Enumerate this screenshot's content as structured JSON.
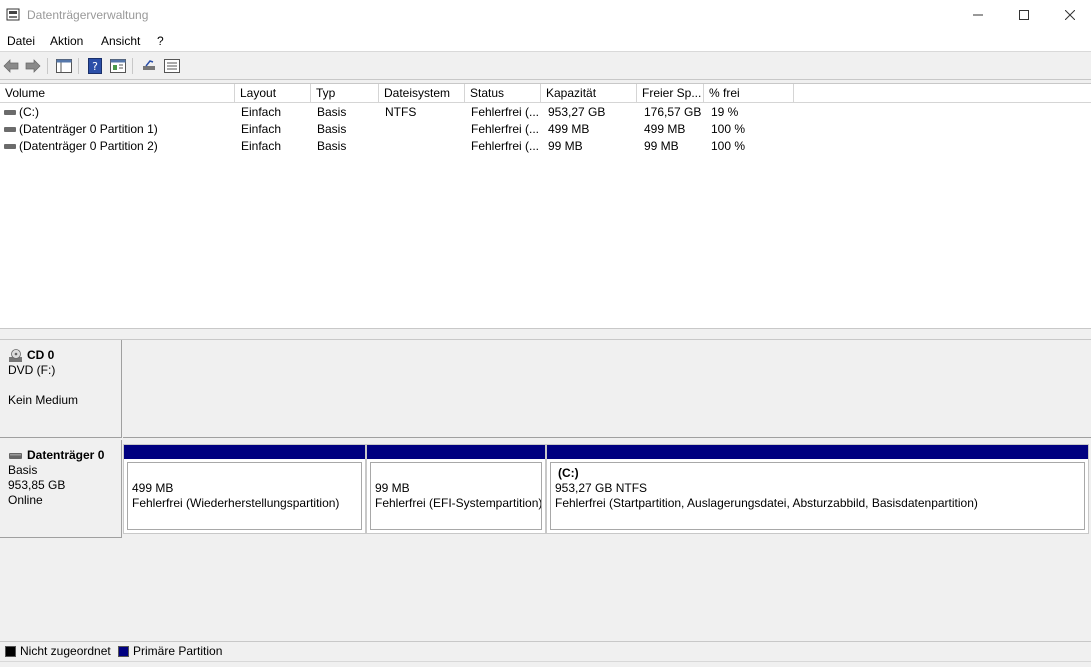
{
  "window": {
    "title": "Datenträgerverwaltung"
  },
  "menu": [
    "Datei",
    "Aktion",
    "Ansicht",
    "?"
  ],
  "toolbar": [
    "back-icon",
    "forward-icon",
    "console-tree-icon",
    "help-icon",
    "properties-icon",
    "connect-icon",
    "settings-icon"
  ],
  "volumes": {
    "columns": [
      "Volume",
      "Layout",
      "Typ",
      "Dateisystem",
      "Status",
      "Kapazität",
      "Freier Sp...",
      "% frei"
    ],
    "rows": [
      {
        "volume": " (C:)",
        "layout": "Einfach",
        "typ": "Basis",
        "fs": "NTFS",
        "status": "Fehlerfrei (...",
        "kap": "953,27 GB",
        "frei": "176,57 GB",
        "pct": "19 %"
      },
      {
        "volume": "(Datenträger 0 Partition 1)",
        "layout": "Einfach",
        "typ": "Basis",
        "fs": "",
        "status": "Fehlerfrei (...",
        "kap": "499 MB",
        "frei": "499 MB",
        "pct": "100 %"
      },
      {
        "volume": "(Datenträger 0 Partition 2)",
        "layout": "Einfach",
        "typ": "Basis",
        "fs": "",
        "status": "Fehlerfrei (...",
        "kap": "99 MB",
        "frei": "99 MB",
        "pct": "100 %"
      }
    ]
  },
  "cd": {
    "name": "CD 0",
    "drive": "DVD (F:)",
    "media": "Kein Medium"
  },
  "disk0": {
    "name": "Datenträger 0",
    "type": "Basis",
    "size": "953,85 GB",
    "state": "Online",
    "partitions": [
      {
        "label": "",
        "size": "499 MB",
        "status": "Fehlerfrei (Wiederherstellungspartition)"
      },
      {
        "label": "",
        "size": "99 MB",
        "status": "Fehlerfrei (EFI-Systempartition)"
      },
      {
        "label": "(C:)",
        "size": "953,27 GB NTFS",
        "status": "Fehlerfrei (Startpartition, Auslagerungsdatei, Absturzabbild, Basisdatenpartition)"
      }
    ]
  },
  "legend": {
    "unallocated": "Nicht zugeordnet",
    "primary": "Primäre Partition",
    "unallocated_color": "#000000",
    "primary_color": "#000080"
  }
}
